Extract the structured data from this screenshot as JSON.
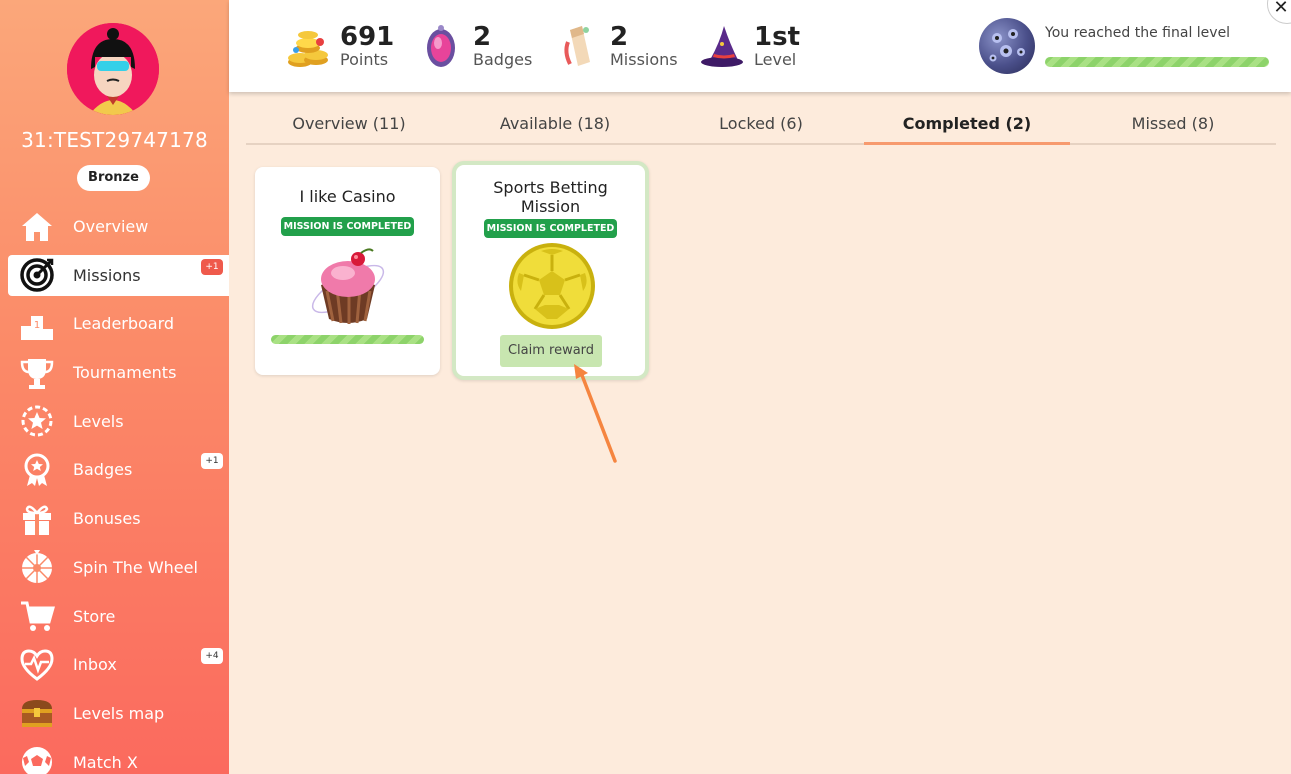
{
  "user": {
    "name": "31:TEST29747178",
    "tier": "Bronze"
  },
  "sidebar": {
    "items": [
      {
        "label": "Overview",
        "icon": "home-icon",
        "badge": ""
      },
      {
        "label": "Missions",
        "icon": "target-icon",
        "badge": "+1"
      },
      {
        "label": "Leaderboard",
        "icon": "podium-icon",
        "badge": ""
      },
      {
        "label": "Tournaments",
        "icon": "trophy-icon",
        "badge": ""
      },
      {
        "label": "Levels",
        "icon": "star-gear-icon",
        "badge": ""
      },
      {
        "label": "Badges",
        "icon": "medal-icon",
        "badge": "+1"
      },
      {
        "label": "Bonuses",
        "icon": "gift-icon",
        "badge": ""
      },
      {
        "label": "Spin The Wheel",
        "icon": "wheel-icon",
        "badge": ""
      },
      {
        "label": "Store",
        "icon": "cart-icon",
        "badge": ""
      },
      {
        "label": "Inbox",
        "icon": "heart-pulse-icon",
        "badge": "+4"
      },
      {
        "label": "Levels map",
        "icon": "treasure-chest-icon",
        "badge": ""
      },
      {
        "label": "Match X",
        "icon": "soccer-ball-icon",
        "badge": ""
      }
    ]
  },
  "header": {
    "stats": [
      {
        "value": "691",
        "label": "Points",
        "icon": "coins-icon"
      },
      {
        "value": "2",
        "label": "Badges",
        "icon": "gem-icon"
      },
      {
        "value": "2",
        "label": "Missions",
        "icon": "scroll-icon"
      },
      {
        "value": "1st",
        "label": "Level",
        "icon": "wizard-hat-icon"
      }
    ],
    "final_level_text": "You reached the final level",
    "final_level_progress": 1.0
  },
  "tabs": [
    {
      "label": "Overview (11)"
    },
    {
      "label": "Available (18)"
    },
    {
      "label": "Locked (6)"
    },
    {
      "label": "Completed (2)"
    },
    {
      "label": "Missed (8)"
    }
  ],
  "active_tab": "Completed (2)",
  "missions": [
    {
      "title": "I like Casino",
      "status": "MISSION IS COMPLETED",
      "progress": 1.0
    },
    {
      "title": "Sports Betting Mission",
      "status": "MISSION IS COMPLETED",
      "action": "Claim reward"
    }
  ],
  "colors": {
    "accent": "#f79a6e",
    "completed_green": "#22a04b",
    "claim_green": "#c8e6b0",
    "sidebar_top": "#fba77a",
    "sidebar_bottom": "#fb6a5e"
  }
}
